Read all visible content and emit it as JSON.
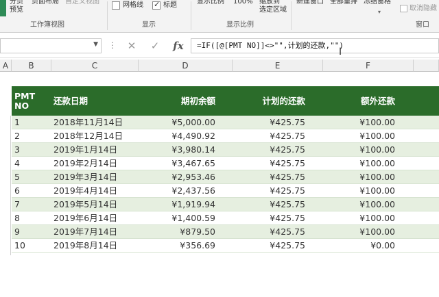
{
  "ribbon": {
    "page_break_preview": "分页\n预览",
    "page_break_preview_1": "分页",
    "page_break_preview_2": "预览",
    "page_layout": "页面布局",
    "custom_views": "自定义视图",
    "group_workbook_views": "工作簿视图",
    "gridlines": "网格线",
    "gridlines_checked": false,
    "headings": "标题",
    "headings_checked": true,
    "group_show": "显示",
    "zoom": "显示比例",
    "zoom_100": "100%",
    "zoom_to_selection_1": "缩放到",
    "zoom_to_selection_2": "选定区域",
    "group_zoom": "显示比例",
    "new_window": "新建窗口",
    "arrange_all": "全部重排",
    "freeze_panes": "冻结窗格",
    "unhide": "取消隐藏",
    "group_window": "窗口"
  },
  "formula_bar": {
    "name_box": "",
    "cancel_glyph": "✕",
    "enter_glyph": "✓",
    "fx_label": "fx",
    "formula": "=IF([@[PMT NO]]<>\"\",计划的还款,\"\")"
  },
  "columns": {
    "letters": [
      "A",
      "B",
      "C",
      "D",
      "E",
      "F"
    ]
  },
  "table": {
    "headers": {
      "pmt_no_1": "PMT",
      "pmt_no_2": "NO",
      "date": "还款日期",
      "beginning_balance": "期初余额",
      "scheduled_payment": "计划的还款",
      "extra_payment": "额外还款"
    },
    "rows": [
      {
        "no": "1",
        "date": "2018年11月14日",
        "balance": "¥5,000.00",
        "scheduled": "¥425.75",
        "extra": "¥100.00"
      },
      {
        "no": "2",
        "date": "2018年12月14日",
        "balance": "¥4,490.92",
        "scheduled": "¥425.75",
        "extra": "¥100.00"
      },
      {
        "no": "3",
        "date": "2019年1月14日",
        "balance": "¥3,980.14",
        "scheduled": "¥425.75",
        "extra": "¥100.00"
      },
      {
        "no": "4",
        "date": "2019年2月14日",
        "balance": "¥3,467.65",
        "scheduled": "¥425.75",
        "extra": "¥100.00"
      },
      {
        "no": "5",
        "date": "2019年3月14日",
        "balance": "¥2,953.46",
        "scheduled": "¥425.75",
        "extra": "¥100.00"
      },
      {
        "no": "6",
        "date": "2019年4月14日",
        "balance": "¥2,437.56",
        "scheduled": "¥425.75",
        "extra": "¥100.00"
      },
      {
        "no": "7",
        "date": "2019年5月14日",
        "balance": "¥1,919.94",
        "scheduled": "¥425.75",
        "extra": "¥100.00"
      },
      {
        "no": "8",
        "date": "2019年6月14日",
        "balance": "¥1,400.59",
        "scheduled": "¥425.75",
        "extra": "¥100.00"
      },
      {
        "no": "9",
        "date": "2019年7月14日",
        "balance": "¥879.50",
        "scheduled": "¥425.75",
        "extra": "¥100.00"
      },
      {
        "no": "10",
        "date": "2019年8月14日",
        "balance": "¥356.69",
        "scheduled": "¥425.75",
        "extra": "¥0.00"
      }
    ]
  },
  "colors": {
    "header_green": "#2b6c2a",
    "band_green": "#e6efe0",
    "accent_green": "#2e8b57"
  }
}
